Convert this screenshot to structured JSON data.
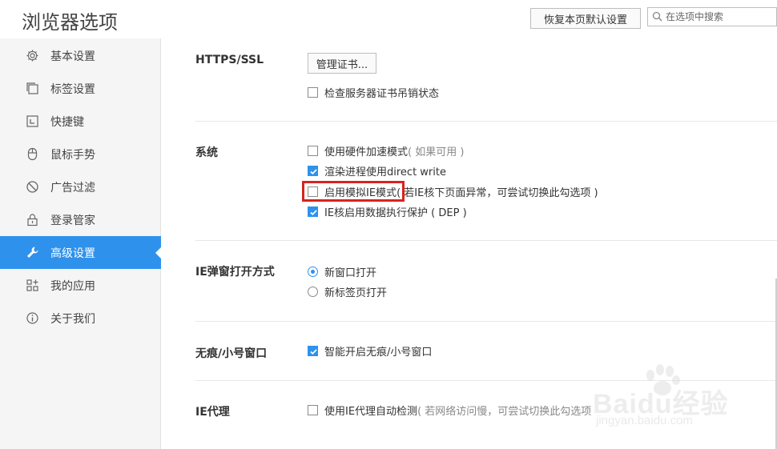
{
  "header": {
    "title": "浏览器选项",
    "restore_label": "恢复本页默认设置",
    "search_placeholder": "在选项中搜索"
  },
  "sidebar": {
    "items": [
      {
        "label": "基本设置",
        "icon": "gear-icon",
        "active": false
      },
      {
        "label": "标签设置",
        "icon": "tabs-icon",
        "active": false
      },
      {
        "label": "快捷键",
        "icon": "keyboard-icon",
        "active": false
      },
      {
        "label": "鼠标手势",
        "icon": "mouse-icon",
        "active": false
      },
      {
        "label": "广告过滤",
        "icon": "block-icon",
        "active": false
      },
      {
        "label": "登录管家",
        "icon": "lock-icon",
        "active": false
      },
      {
        "label": "高级设置",
        "icon": "wrench-icon",
        "active": true
      },
      {
        "label": "我的应用",
        "icon": "apps-icon",
        "active": false
      },
      {
        "label": "关于我们",
        "icon": "info-icon",
        "active": false
      }
    ]
  },
  "sections": {
    "https": {
      "title": "HTTPS/SSL",
      "manage_cert_label": "管理证书...",
      "check_revocation": {
        "label": "检查服务器证书吊销状态",
        "checked": false
      }
    },
    "system": {
      "title": "系统",
      "options": [
        {
          "label": "使用硬件加速模式",
          "hint": "( 如果可用 )",
          "checked": false
        },
        {
          "label": "渲染进程使用direct write",
          "hint": "",
          "checked": true
        },
        {
          "label": "启用模拟IE模式",
          "hint": "( 若IE核下页面异常，可尝试切换此勾选项 )",
          "checked": false
        },
        {
          "label": "IE核启用数据执行保护 ( DEP )",
          "hint": "",
          "checked": true
        }
      ]
    },
    "ie_popup": {
      "title": "IE弹窗打开方式",
      "options": [
        {
          "label": "新窗口打开",
          "selected": true
        },
        {
          "label": "新标签页打开",
          "selected": false
        }
      ]
    },
    "incognito": {
      "title": "无痕/小号窗口",
      "option": {
        "label": "智能开启无痕/小号窗口",
        "checked": true
      }
    },
    "ie_proxy": {
      "title": "IE代理",
      "option": {
        "label": "使用IE代理自动检测",
        "hint": "( 若网络访问慢，可尝试切换此勾选项",
        "checked": false
      }
    }
  },
  "watermark": {
    "brand": "Baidu经验",
    "url": "jingyan.baidu.com"
  },
  "colors": {
    "accent": "#2e92ec",
    "highlight": "#d9231e",
    "sidebar_bg": "#f5f5f5"
  }
}
